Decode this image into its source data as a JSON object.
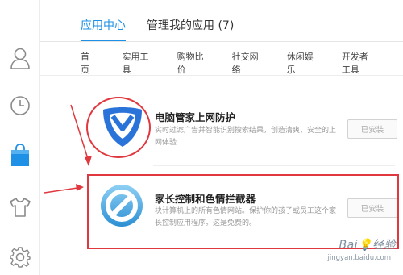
{
  "tabs": [
    {
      "label": "应用中心"
    },
    {
      "label": "管理我的应用 (7)"
    }
  ],
  "subnav": [
    {
      "label": "首页"
    },
    {
      "label": "实用工具"
    },
    {
      "label": "购物比价"
    },
    {
      "label": "社交网络"
    },
    {
      "label": "休闲娱乐"
    },
    {
      "label": "开发者工具"
    }
  ],
  "apps": [
    {
      "title": "电脑管家上网防护",
      "desc": "实时过滤广告并智能识别搜索结果，创造清爽、安全的上网体验",
      "button": "已安装",
      "icon": "tencent-pc-manager-shield-icon"
    },
    {
      "title": "家长控制和色情拦截器",
      "desc": "块计算机上的所有色情网站。保护你的孩子或员工这个家长控制应用程序。这是免费的。",
      "button": "已安装",
      "icon": "blocked-circle-icon"
    }
  ],
  "sidebar_icons": [
    "user-icon",
    "clock-icon",
    "shopping-bag-icon",
    "shirt-icon",
    "gear-icon"
  ],
  "watermark": {
    "main": "Bai💡经验",
    "sub": "jingyan.baidu.com"
  },
  "colors": {
    "accent": "#1e90e6",
    "annotation": "#e0383e",
    "text": "#333333",
    "muted": "#999999"
  }
}
